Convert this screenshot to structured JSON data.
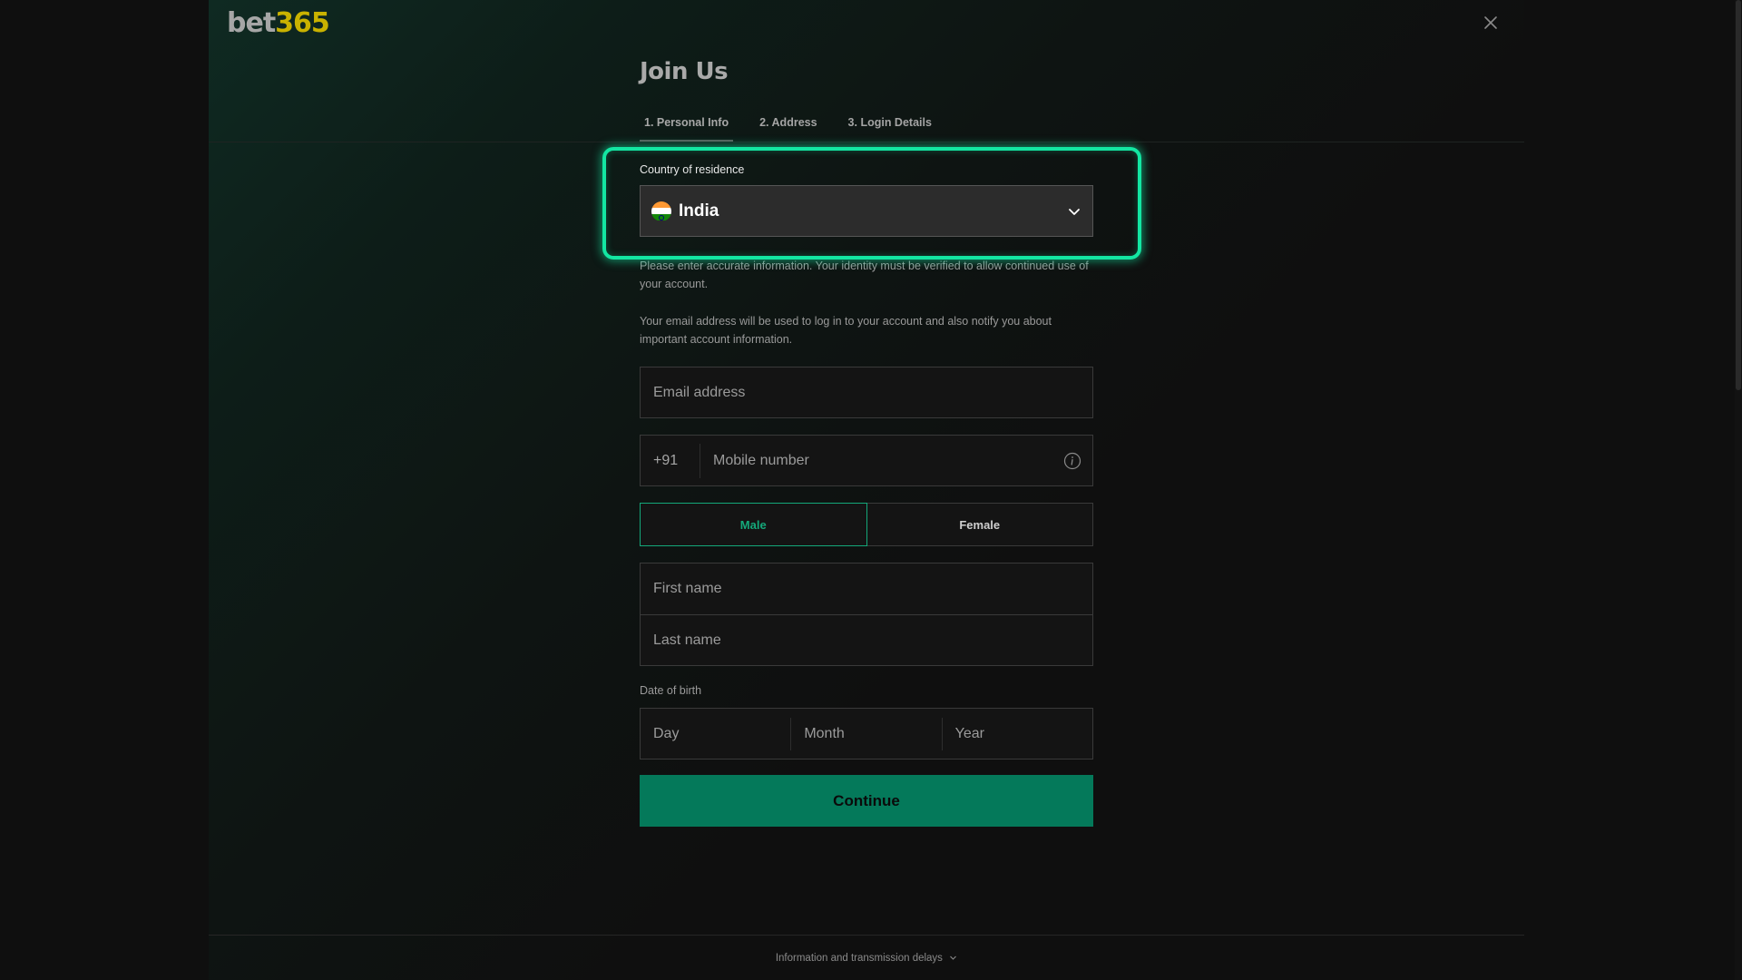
{
  "logo": {
    "part1": "bet",
    "part2": "365"
  },
  "title": "Join Us",
  "tabs": [
    {
      "label": "1. Personal Info",
      "active": true
    },
    {
      "label": "2. Address",
      "active": false
    },
    {
      "label": "3. Login Details",
      "active": false
    }
  ],
  "country": {
    "label": "Country of residence",
    "value": "India",
    "flag_icon": "india-flag-icon"
  },
  "help": {
    "identity": "Please enter accurate information. Your identity must be verified to allow continued use of your account.",
    "email_note": "Your email address will be used to log in to your account and also notify you about important account information."
  },
  "email": {
    "placeholder": "Email address",
    "value": ""
  },
  "phone": {
    "prefix": "+91",
    "placeholder": "Mobile number",
    "value": ""
  },
  "gender": {
    "male": "Male",
    "female": "Female",
    "selected": "Male"
  },
  "first_name": {
    "placeholder": "First name",
    "value": ""
  },
  "last_name": {
    "placeholder": "Last name",
    "value": ""
  },
  "dob": {
    "label": "Date of birth",
    "day": "Day",
    "month": "Month",
    "year": "Year"
  },
  "continue_label": "Continue",
  "footer": {
    "link": "Information and transmission delays"
  },
  "colors": {
    "accent": "#04795a",
    "highlight": "#13e6a2",
    "selected_text": "#14a87a",
    "logo_365": "#c9b200"
  }
}
